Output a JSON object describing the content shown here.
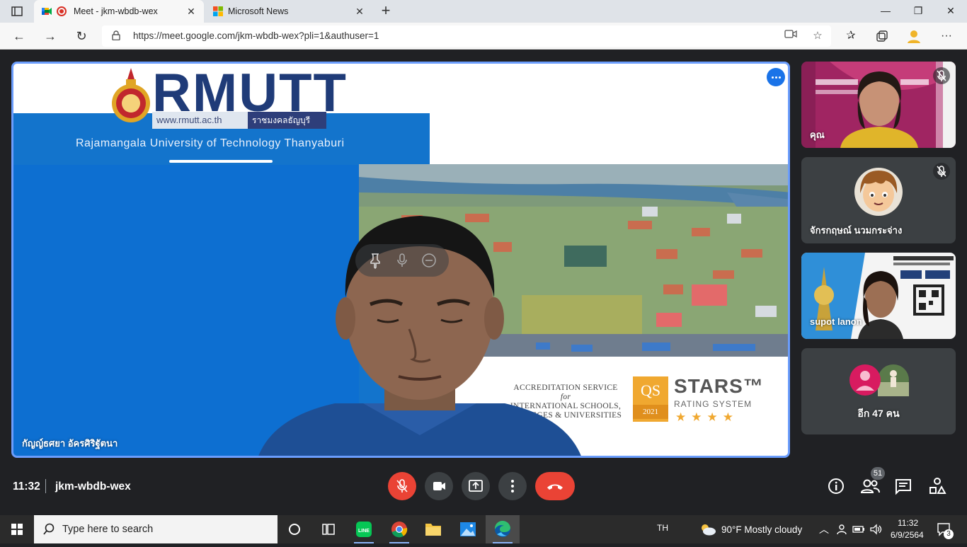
{
  "browser": {
    "tabs": [
      {
        "title": "Meet - jkm-wbdb-wex",
        "active": true
      },
      {
        "title": "Microsoft News",
        "active": false
      }
    ],
    "url": "https://meet.google.com/jkm-wbdb-wex?pli=1&authuser=1"
  },
  "meeting": {
    "main_speaker": "กัญญ์ธศยา อัครศิริฐัตนา",
    "slide": {
      "logo": "RMUTT",
      "website": "www.rmutt.ac.th",
      "website_thai": "ราชมงคลธัญบุรี",
      "university": "Rajamangala University of Technology Thanyaburi",
      "accreditation": [
        "ACCREDITATION SERVICE",
        "for",
        "INTERNATIONAL SCHOOLS,",
        "COLLEGES & UNIVERSITIES"
      ],
      "qs_box": "QS",
      "qs_year": "2021",
      "stars_title": "STARS™",
      "stars_sub": "RATING SYSTEM",
      "stars_count": 4
    },
    "participants": [
      {
        "name": "คุณ",
        "muted": true
      },
      {
        "name": "จักรกฤษณ์ นวมกระจ่าง",
        "muted": true
      },
      {
        "name": "supot lanon",
        "muted": false
      },
      {
        "name": "อีก 47 คน",
        "muted": false
      }
    ],
    "participant_count": "51",
    "time": "11:32",
    "code": "jkm-wbdb-wex",
    "colors": {
      "accent": "#1a73e8",
      "end_call": "#ea4335",
      "bg": "#202124"
    }
  },
  "taskbar": {
    "search_placeholder": "Type here to search",
    "language": "TH",
    "weather": "90°F  Mostly cloudy",
    "time": "11:32",
    "date": "6/9/2564",
    "notifications": "3"
  }
}
